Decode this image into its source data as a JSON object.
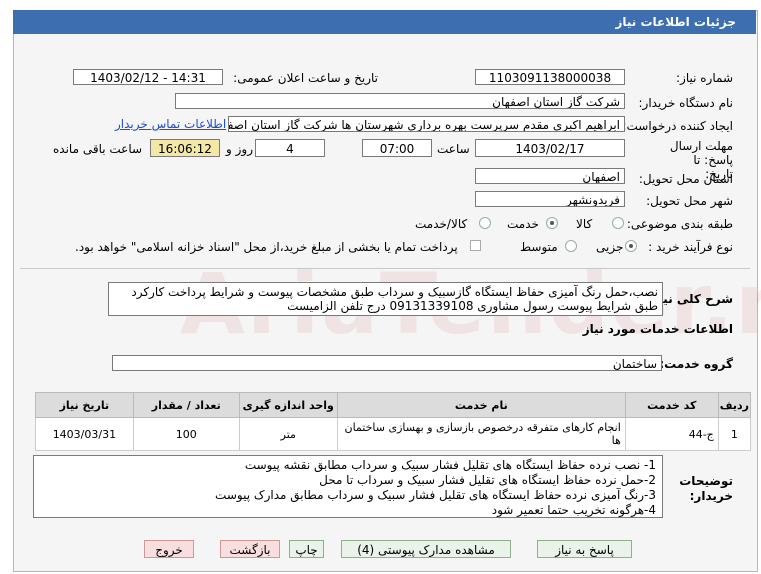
{
  "window": {
    "title": "جزئیات اطلاعات نیاز"
  },
  "watermark": "AriaTender.net",
  "form": {
    "need_number": {
      "label": "شماره نیاز:",
      "value": "1103091138000038"
    },
    "announce_datetime": {
      "label": "تاریخ و ساعت اعلان عمومی:",
      "value": "1403/02/12 - 14:31"
    },
    "buyer_org": {
      "label": "نام دستگاه خریدار:",
      "value": "شرکت گاز استان اصفهان"
    },
    "requester": {
      "label": "ایجاد کننده درخواست:",
      "value": "ابراهیم اکبری مقدم سرپرست بهره برداری شهرستان ها شرکت گاز استان اصفه",
      "contact_link": "اطلاعات تماس خریدار"
    },
    "deadline": {
      "label": "مهلت ارسال پاسخ: تا تاریخ:",
      "date": "1403/02/17",
      "time_label": "ساعت",
      "time": "07:00",
      "days": "4",
      "days_label": "روز و",
      "remaining": "16:06:12",
      "remaining_label": "ساعت باقی مانده"
    },
    "province": {
      "label": "استان محل تحویل:",
      "value": "اصفهان"
    },
    "city": {
      "label": "شهر محل تحویل:",
      "value": "فریدونشهر"
    },
    "category": {
      "label": "طبقه بندی موضوعی:",
      "options": [
        "کالا",
        "خدمت",
        "کالا/خدمت"
      ],
      "selected": "خدمت"
    },
    "process": {
      "label": "نوع فرآیند خرید :",
      "options": [
        "جزیی",
        "متوسط"
      ],
      "selected": "جزیی",
      "payment_note": "پرداخت تمام یا بخشی از مبلغ خرید،از محل \"اسناد خزانه اسلامی\" خواهد بود."
    }
  },
  "summary": {
    "label": "شرح کلی نیاز:",
    "text": "نصب،حمل رنگ آمیزی حفاظ ایستگاه گازسبیک و سرداب طبق مشخصات پیوست و شرایط پرداخت کارکرد طبق شرایط پیوست رسول مشاوری 09131339108 درج تلفن الزامیست"
  },
  "services_section": {
    "title": "اطلاعات خدمات مورد نیاز"
  },
  "service_group": {
    "label": "گروه خدمت:",
    "value": "ساختمان"
  },
  "services_table": {
    "headers": [
      "ردیف",
      "کد خدمت",
      "نام خدمت",
      "واحد اندازه گیری",
      "تعداد / مقدار",
      "تاریخ نیاز"
    ],
    "rows": [
      [
        "1",
        "ج-44",
        "انجام کارهای متفرقه درخصوص بازسازی و بهسازی ساختمان ها",
        "متر",
        "100",
        "1403/03/31"
      ]
    ]
  },
  "buyer_notes": {
    "label": "توضیحات خریدار:",
    "lines": [
      "1- نصب نرده حفاظ ایستگاه های تقلیل فشار سبیک و سرداب مطابق نقشه پیوست",
      "2-حمل نرده حفاظ ایستگاه های تقلیل فشار سبیک و سرداب تا محل",
      "3-رنگ آمیزی نرده حفاظ ایستگاه های تقلیل فشار سبیک و سرداب مطابق مدارک پیوست",
      "4-هرگونه تخریب حتما تعمیر شود"
    ]
  },
  "buttons": {
    "reply": "پاسخ به نیاز",
    "view_docs": "مشاهده مدارک پیوستی (4)",
    "print": "چاپ",
    "back": "بازگشت",
    "exit": "خروج"
  }
}
